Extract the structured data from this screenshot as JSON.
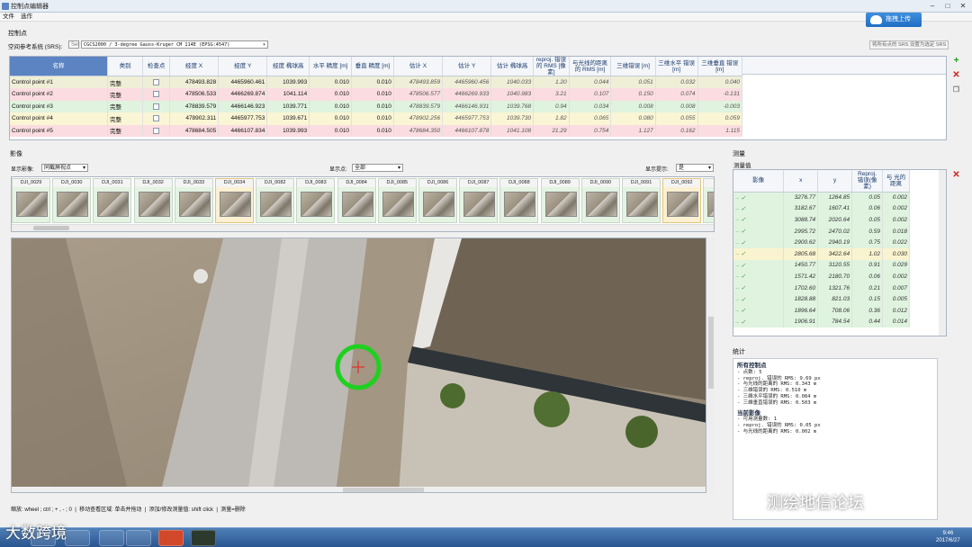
{
  "window": {
    "title": "控制点编辑器"
  },
  "menu": [
    "文件",
    "选作"
  ],
  "upload_label": "拖拽上传",
  "gcp_section": {
    "title": "控制点",
    "crs_label": "空间参考系统 (SRS):",
    "crs_value": "CGCS2000 / 3-degree Gauss-Kruger CM 114E (EPSG:4547)",
    "crs_btn": "Set",
    "crs_right_label": "将所有点的 SRS 设置为选定 SRS",
    "columns": [
      "名称",
      "类别",
      "检查点",
      "经度 X",
      "经度 Y",
      "经度 椭球高",
      "水平 精度 [m]",
      "垂直 精度 [m]",
      "估计 X",
      "估计 Y",
      "估计 椭球高",
      "reproj. 错误的 RMS [像素]",
      "与光线的距离 的 RMS [m]",
      "三维错误 [m]",
      "三维水平 错误 [m]",
      "三维垂直 错误 [m]"
    ],
    "rows": [
      [
        "Control point #1",
        "完整",
        "",
        "478493.828",
        "4465960.461",
        "1039.993",
        "0.010",
        "0.010",
        "478493.859",
        "4465960.456",
        "1040.033",
        "1.20",
        "0.044",
        "0.051",
        "0.032",
        "0.040"
      ],
      [
        "Control point #2",
        "完整",
        "",
        "478506.533",
        "4466269.874",
        "1041.114",
        "0.010",
        "0.010",
        "478506.577",
        "4466269.933",
        "1040.983",
        "3.21",
        "0.107",
        "0.150",
        "0.074",
        "-0.131"
      ],
      [
        "Control point #3",
        "完整",
        "",
        "478839.579",
        "4466146.923",
        "1039.771",
        "0.010",
        "0.010",
        "478839.579",
        "4466146.931",
        "1039.768",
        "0.94",
        "0.034",
        "0.008",
        "0.008",
        "-0.003"
      ],
      [
        "Control point #4",
        "完整",
        "",
        "478902.311",
        "4465977.753",
        "1039.671",
        "0.010",
        "0.010",
        "478902.256",
        "4465977.753",
        "1039.730",
        "1.82",
        "0.065",
        "0.080",
        "0.055",
        "0.059"
      ],
      [
        "Control point #5",
        "完整",
        "",
        "478684.505",
        "4466107.834",
        "1039.993",
        "0.010",
        "0.010",
        "478684.350",
        "4466107.878",
        "1041.108",
        "21.29",
        "0.754",
        "1.127",
        "0.162",
        "1.115"
      ]
    ]
  },
  "images_section": {
    "title": "影像",
    "show_label": "显示影像:",
    "show_value": "同截屏视点",
    "points_label": "显示点:",
    "points_value": "全部",
    "hint_label": "显示提示:",
    "hint_value": "是",
    "thumbs": [
      "DJI_0029",
      "DJI_0030",
      "DJI_0031",
      "DJI_0032",
      "DJI_0033",
      "DJI_0034",
      "DJI_0082",
      "DJI_0083",
      "DJI_0084",
      "DJI_0085",
      "DJI_0086",
      "DJI_0087",
      "DJI_0088",
      "DJI_0089",
      "DJI_0090",
      "DJI_0091",
      "DJI_0092",
      "DJ"
    ]
  },
  "measure_section": {
    "title": "测量",
    "subtitle": "测量值",
    "columns": [
      "影像",
      "x",
      "y",
      "Reproj. 错误(像素)",
      "与 光的距离"
    ],
    "rows": [
      [
        "3276.77",
        "1264.85",
        "0.05",
        "0.002"
      ],
      [
        "3182.67",
        "1607.41",
        "0.06",
        "0.002"
      ],
      [
        "3088.74",
        "2020.64",
        "0.05",
        "0.002"
      ],
      [
        "2995.72",
        "2470.02",
        "0.59",
        "0.018"
      ],
      [
        "2900.62",
        "2940.19",
        "0.75",
        "0.022"
      ],
      [
        "2805.68",
        "3422.64",
        "1.02",
        "0.030"
      ],
      [
        "1450.77",
        "3120.55",
        "0.91",
        "0.029"
      ],
      [
        "1571.42",
        "2180.70",
        "0.06",
        "0.002"
      ],
      [
        "1702.60",
        "1321.76",
        "0.21",
        "0.007"
      ],
      [
        "1828.88",
        "821.03",
        "0.15",
        "0.005"
      ],
      [
        "1896.64",
        "708.06",
        "0.36",
        "0.012"
      ],
      [
        "1906.91",
        "784.54",
        "0.44",
        "0.014"
      ]
    ],
    "row_prefix": "·· ✓"
  },
  "stats_section": {
    "title": "统计",
    "all_title": "所有控制点",
    "all_lines": [
      "- 点数: 5",
      "- reproj. 错误的 RMS: 9.69 px",
      "- 与光线的距离的 RMS: 0.343 m",
      "- 三维错误的 RMS: 0.510 m",
      "- 三维水平错误的 RMS: 0.084 m",
      "- 三维垂直错误的 RMS: 0.503 m"
    ],
    "cur_title": "当前影像",
    "cur_lines": [
      "- 可用测量数: 1",
      "- reproj. 错误的 RMS: 0.05 px",
      "- 与光线的距离的 RMS: 0.002 m"
    ]
  },
  "status": [
    "缩放: wheel ; ctrl ; + , - ; 0",
    "移动查看区域: 单击并拖动",
    "添加/修改测量值: shift click",
    "测量=删除"
  ],
  "watermark": "测绘地信论坛",
  "watermark2": "大数跨境",
  "clock": {
    "time": "9:46",
    "date": "2017/6/27"
  },
  "colors": {
    "accent": "#5c84c2",
    "green_marker": "#1fd11f",
    "red_cross": "#e0302c"
  }
}
